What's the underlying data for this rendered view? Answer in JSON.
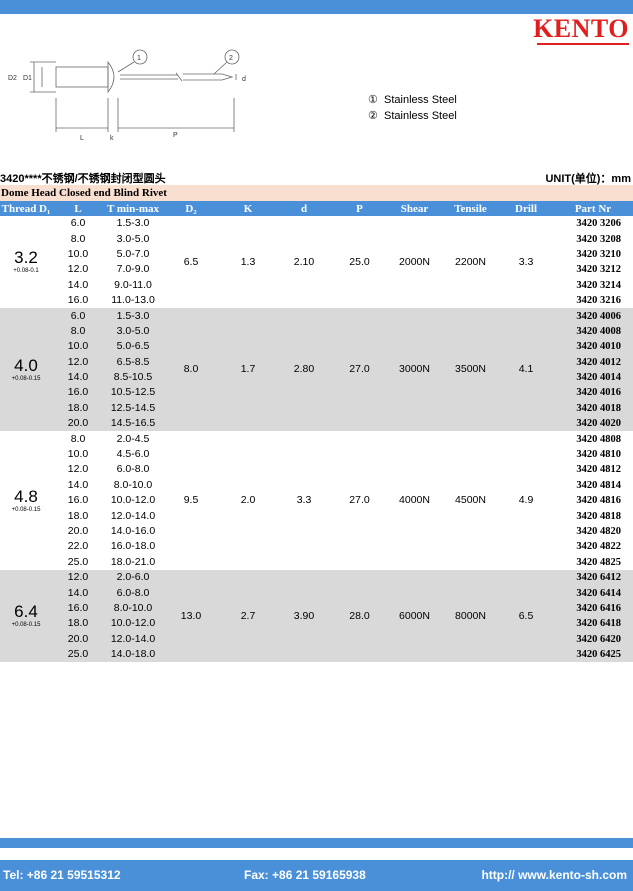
{
  "brand": {
    "logo": "KENTO"
  },
  "diagram": {
    "callout_1": "1",
    "callout_2": "2",
    "labels": {
      "d2": "D2",
      "d1": "D1",
      "l": "L",
      "k": "k",
      "p": "P",
      "d": "d"
    }
  },
  "materials": [
    {
      "marker": "①",
      "text": "Stainless Steel"
    },
    {
      "marker": "②",
      "text": "Stainless Steel"
    }
  ],
  "header": {
    "code_title": "3420****不锈钢/不锈钢封闭型圆头",
    "unit": "UNIT(单位)：mm",
    "english_title": "Dome Head Closed end Blind Rivet"
  },
  "table": {
    "columns": [
      "Thread D₁",
      "L",
      "T min-max",
      "D₂",
      "K",
      "d",
      "P",
      "Shear",
      "Tensile",
      "Drill",
      "Part Nr"
    ],
    "groups": [
      {
        "thread": "3.2",
        "tolerance": "+0.08-0.1",
        "d2": "6.5",
        "k": "1.3",
        "d": "2.10",
        "p": "25.0",
        "shear": "2000N",
        "tensile": "2200N",
        "drill": "3.3",
        "grey": false,
        "rows": [
          {
            "l": "6.0",
            "t": "1.5-3.0",
            "part": "3420 3206"
          },
          {
            "l": "8.0",
            "t": "3.0-5.0",
            "part": "3420 3208"
          },
          {
            "l": "10.0",
            "t": "5.0-7.0",
            "part": "3420 3210"
          },
          {
            "l": "12.0",
            "t": "7.0-9.0",
            "part": "3420 3212"
          },
          {
            "l": "14.0",
            "t": "9.0-11.0",
            "part": "3420 3214"
          },
          {
            "l": "16.0",
            "t": "11.0-13.0",
            "part": "3420 3216"
          }
        ]
      },
      {
        "thread": "4.0",
        "tolerance": "+0.08-0.15",
        "d2": "8.0",
        "k": "1.7",
        "d": "2.80",
        "p": "27.0",
        "shear": "3000N",
        "tensile": "3500N",
        "drill": "4.1",
        "grey": true,
        "rows": [
          {
            "l": "6.0",
            "t": "1.5-3.0",
            "part": "3420 4006"
          },
          {
            "l": "8.0",
            "t": "3.0-5.0",
            "part": "3420 4008"
          },
          {
            "l": "10.0",
            "t": "5.0-6.5",
            "part": "3420 4010"
          },
          {
            "l": "12.0",
            "t": "6.5-8.5",
            "part": "3420 4012"
          },
          {
            "l": "14.0",
            "t": "8.5-10.5",
            "part": "3420 4014"
          },
          {
            "l": "16.0",
            "t": "10.5-12.5",
            "part": "3420 4016"
          },
          {
            "l": "18.0",
            "t": "12.5-14.5",
            "part": "3420 4018"
          },
          {
            "l": "20.0",
            "t": "14.5-16.5",
            "part": "3420 4020"
          }
        ]
      },
      {
        "thread": "4.8",
        "tolerance": "+0.08-0.15",
        "d2": "9.5",
        "k": "2.0",
        "d": "3.3",
        "p": "27.0",
        "shear": "4000N",
        "tensile": "4500N",
        "drill": "4.9",
        "grey": false,
        "rows": [
          {
            "l": "8.0",
            "t": "2.0-4.5",
            "part": "3420 4808"
          },
          {
            "l": "10.0",
            "t": "4.5-6.0",
            "part": "3420 4810"
          },
          {
            "l": "12.0",
            "t": "6.0-8.0",
            "part": "3420 4812"
          },
          {
            "l": "14.0",
            "t": "8.0-10.0",
            "part": "3420 4814"
          },
          {
            "l": "16.0",
            "t": "10.0-12.0",
            "part": "3420 4816"
          },
          {
            "l": "18.0",
            "t": "12.0-14.0",
            "part": "3420 4818"
          },
          {
            "l": "20.0",
            "t": "14.0-16.0",
            "part": "3420 4820"
          },
          {
            "l": "22.0",
            "t": "16.0-18.0",
            "part": "3420 4822"
          },
          {
            "l": "25.0",
            "t": "18.0-21.0",
            "part": "3420 4825"
          }
        ]
      },
      {
        "thread": "6.4",
        "tolerance": "+0.08-0.15",
        "d2": "13.0",
        "k": "2.7",
        "d": "3.90",
        "p": "28.0",
        "shear": "6000N",
        "tensile": "8000N",
        "drill": "6.5",
        "grey": true,
        "rows": [
          {
            "l": "12.0",
            "t": "2.0-6.0",
            "part": "3420 6412"
          },
          {
            "l": "14.0",
            "t": "6.0-8.0",
            "part": "3420 6414"
          },
          {
            "l": "16.0",
            "t": "8.0-10.0",
            "part": "3420 6416"
          },
          {
            "l": "18.0",
            "t": "10.0-12.0",
            "part": "3420 6418"
          },
          {
            "l": "20.0",
            "t": "12.0-14.0",
            "part": "3420 6420"
          },
          {
            "l": "25.0",
            "t": "14.0-18.0",
            "part": "3420 6425"
          }
        ]
      }
    ]
  },
  "footer": {
    "tel": "Tel: +86 21 59515312",
    "fax": "Fax: +86 21 59165938",
    "web": "http:// www.kento-sh.com"
  },
  "colors": {
    "accent": "#4a90d9",
    "brand_red": "#e02020",
    "band": "#f8dfd0",
    "grey_row": "#d9d9d9"
  }
}
